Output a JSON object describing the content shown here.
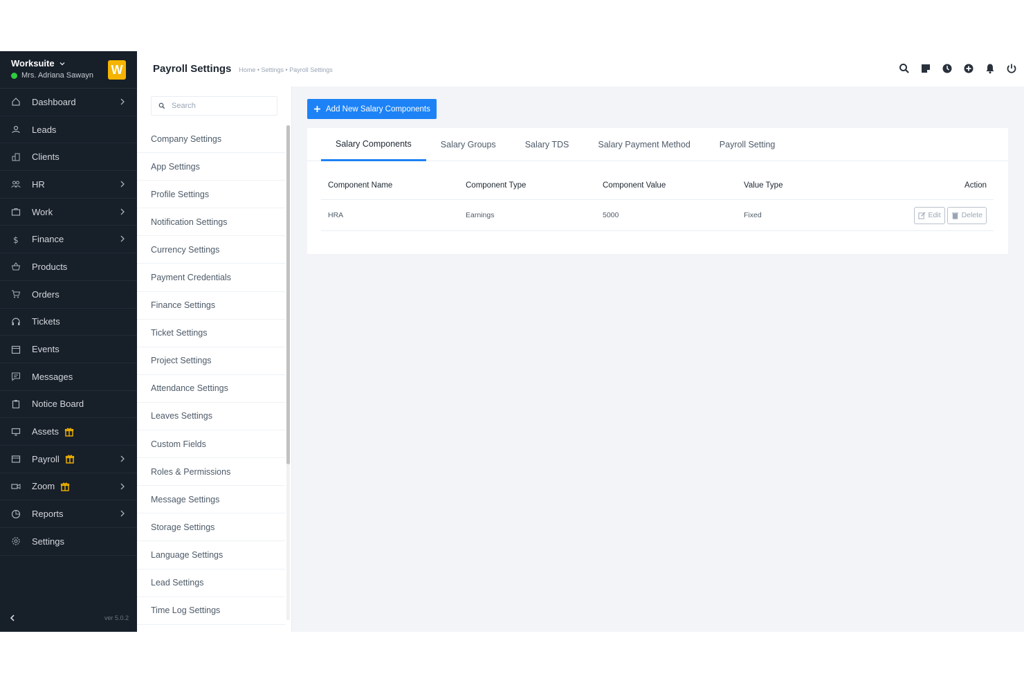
{
  "sidebar": {
    "brand": "Worksuite",
    "user": "Mrs. Adriana Sawayn",
    "logo_letter": "W",
    "version": "ver 5.0.2",
    "items": [
      {
        "label": "Dashboard",
        "icon": "home-icon",
        "chevron": true
      },
      {
        "label": "Leads",
        "icon": "user-icon",
        "chevron": false
      },
      {
        "label": "Clients",
        "icon": "building-icon",
        "chevron": false
      },
      {
        "label": "HR",
        "icon": "people-icon",
        "chevron": true
      },
      {
        "label": "Work",
        "icon": "briefcase-icon",
        "chevron": true
      },
      {
        "label": "Finance",
        "icon": "dollar-icon",
        "chevron": true
      },
      {
        "label": "Products",
        "icon": "basket-icon",
        "chevron": false
      },
      {
        "label": "Orders",
        "icon": "cart-icon",
        "chevron": false
      },
      {
        "label": "Tickets",
        "icon": "headset-icon",
        "chevron": false
      },
      {
        "label": "Events",
        "icon": "calendar-icon",
        "chevron": false
      },
      {
        "label": "Messages",
        "icon": "chat-icon",
        "chevron": false
      },
      {
        "label": "Notice Board",
        "icon": "clipboard-icon",
        "chevron": false
      },
      {
        "label": "Assets",
        "icon": "monitor-icon",
        "chevron": false,
        "gift": true
      },
      {
        "label": "Payroll",
        "icon": "wallet-icon",
        "chevron": true,
        "gift": true
      },
      {
        "label": "Zoom",
        "icon": "video-icon",
        "chevron": true,
        "gift": true
      },
      {
        "label": "Reports",
        "icon": "pie-chart-icon",
        "chevron": true
      },
      {
        "label": "Settings",
        "icon": "gear-icon",
        "chevron": false
      }
    ]
  },
  "header": {
    "title": "Payroll Settings",
    "breadcrumb": "Home • Settings • Payroll Settings"
  },
  "settings_panel": {
    "search_placeholder": "Search",
    "items": [
      "Company Settings",
      "App Settings",
      "Profile Settings",
      "Notification Settings",
      "Currency Settings",
      "Payment Credentials",
      "Finance Settings",
      "Ticket Settings",
      "Project Settings",
      "Attendance Settings",
      "Leaves Settings",
      "Custom Fields",
      "Roles & Permissions",
      "Message Settings",
      "Storage Settings",
      "Language Settings",
      "Lead Settings",
      "Time Log Settings"
    ]
  },
  "main": {
    "add_button": "Add New Salary Components",
    "tabs": [
      "Salary Components",
      "Salary Groups",
      "Salary TDS",
      "Salary Payment Method",
      "Payroll Setting"
    ],
    "active_tab": 0,
    "columns": [
      "Component Name",
      "Component Type",
      "Component Value",
      "Value Type",
      "Action"
    ],
    "rows": [
      {
        "name": "HRA",
        "type": "Earnings",
        "value": "5000",
        "value_type": "Fixed"
      }
    ],
    "edit_label": "Edit",
    "delete_label": "Delete"
  },
  "colors": {
    "accent": "#1d82f5",
    "sidebar": "#171f29",
    "logo": "#f5b400",
    "online": "#2ecc40",
    "gift": "#f5b400"
  }
}
